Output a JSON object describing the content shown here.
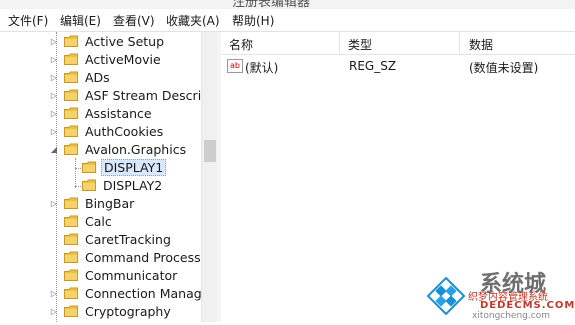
{
  "window": {
    "title": "注册表编辑器"
  },
  "menu": [
    "文件(F)",
    "编辑(E)",
    "查看(V)",
    "收藏夹(A)",
    "帮助(H)"
  ],
  "tree": {
    "items": [
      {
        "label": "Active Setup",
        "expander": "▷"
      },
      {
        "label": "ActiveMovie",
        "expander": "▷"
      },
      {
        "label": "ADs",
        "expander": "▷"
      },
      {
        "label": "ASF Stream Descrip",
        "expander": "▷"
      },
      {
        "label": "Assistance",
        "expander": "▷"
      },
      {
        "label": "AuthCookies",
        "expander": "▷"
      },
      {
        "label": "Avalon.Graphics",
        "expander": "◢"
      },
      {
        "label": "DISPLAY1",
        "expander": "",
        "child": true,
        "selected": true
      },
      {
        "label": "DISPLAY2",
        "expander": "",
        "child": true
      },
      {
        "label": "BingBar",
        "expander": "▷"
      },
      {
        "label": "Calc",
        "expander": ""
      },
      {
        "label": "CaretTracking",
        "expander": ""
      },
      {
        "label": "Command Processo",
        "expander": ""
      },
      {
        "label": "Communicator",
        "expander": ""
      },
      {
        "label": "Connection Manage",
        "expander": "▷"
      },
      {
        "label": "Cryptography",
        "expander": "▷"
      }
    ]
  },
  "list": {
    "columns": [
      "名称",
      "类型",
      "数据"
    ],
    "rows": [
      {
        "name": "(默认)",
        "type": "REG_SZ",
        "data": "(数值未设置)",
        "icon": "ab"
      }
    ]
  },
  "watermark": {
    "brand": "系统城",
    "site_cn": "织梦内容管理系统",
    "site_en": "DEDECMS.COM",
    "url": "xitongcheng.com"
  },
  "colors": {
    "folder": "#e8c04a",
    "selection": "#d9e8fb",
    "logo_blue": "#1a8fd6"
  }
}
